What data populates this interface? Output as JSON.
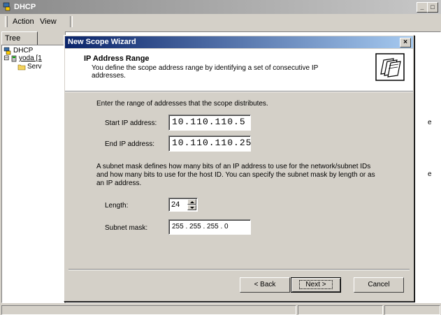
{
  "console": {
    "title": "DHCP",
    "menu": {
      "action": "Action",
      "view": "View"
    },
    "tree_tab": "Tree",
    "tree": {
      "root": "DHCP",
      "server": "yoda [1",
      "scope": "Serv"
    },
    "right_fragments": [
      "e",
      "e"
    ]
  },
  "wizard": {
    "title": "New Scope Wizard",
    "header": {
      "title": "IP Address Range",
      "subtitle": "You define the scope address range by identifying a set of consecutive IP addresses."
    },
    "intro": "Enter the range of addresses that the scope distributes.",
    "start_ip": {
      "label": "Start IP address:",
      "value": "10.110.110.5"
    },
    "end_ip": {
      "label": "End IP address:",
      "value": "10.110.110.25"
    },
    "subnet_text": "A subnet mask defines how many bits of an IP address to use for the network/subnet IDs and how many bits to use for the host ID. You can specify the subnet mask by length or as an IP address.",
    "length": {
      "label": "Length:",
      "value": "24"
    },
    "subnet_mask": {
      "label": "Subnet mask:",
      "value": "255 . 255 . 255 .  0"
    },
    "buttons": {
      "back": "< Back",
      "next": "Next >",
      "cancel": "Cancel"
    }
  }
}
